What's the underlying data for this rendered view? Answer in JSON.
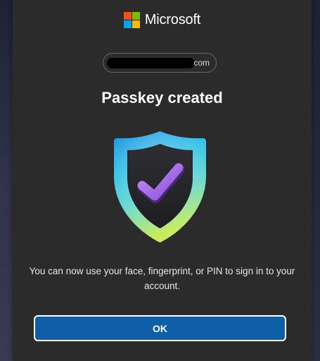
{
  "brand": {
    "name": "Microsoft",
    "logo_colors": [
      "#f25022",
      "#7fba00",
      "#00a4ef",
      "#ffb900"
    ]
  },
  "account": {
    "visible_suffix": "com"
  },
  "dialog": {
    "title": "Passkey created",
    "message": "You can now use your face, fingerprint, or PIN to sign in to your account.",
    "ok_label": "OK",
    "illustration_icon": "shield-check-icon"
  },
  "colors": {
    "dialog_bg": "#2b2b2b",
    "primary_button": "#0f5ea8",
    "check_purple": "#9b5de5"
  }
}
